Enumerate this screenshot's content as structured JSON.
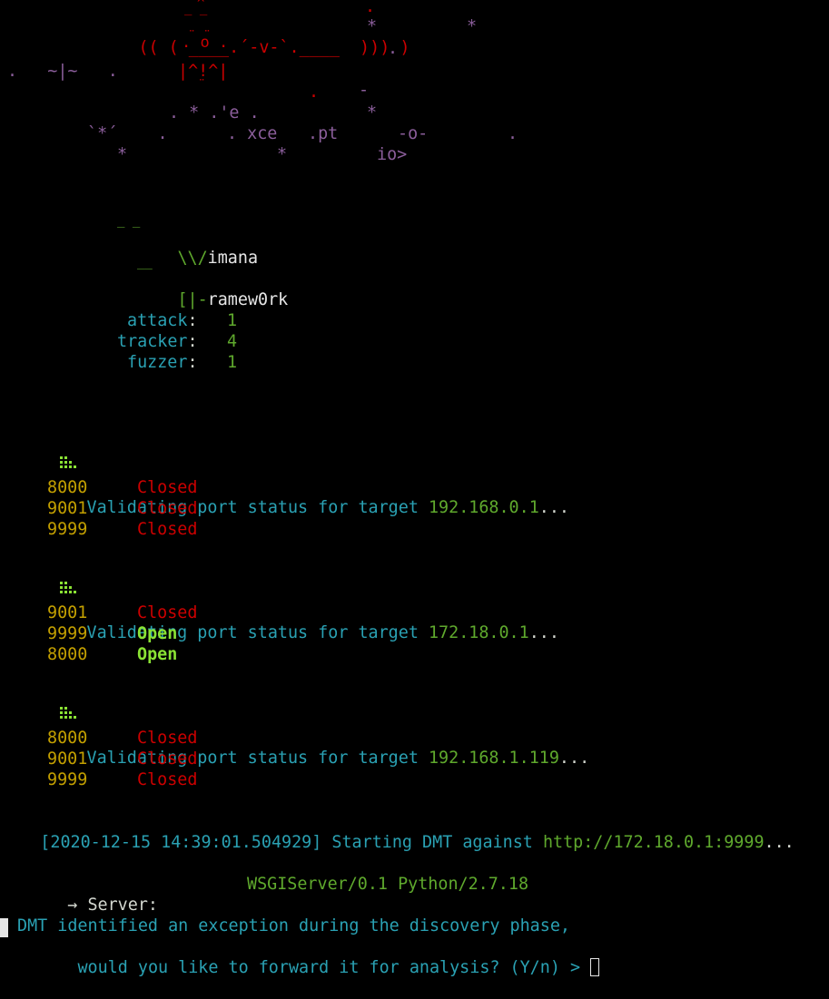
{
  "banner": {
    "line1": {
      "left": "(( ( ____.",
      "mid": "´-v-`",
      "right": ".____  ))) )",
      "star1": "*",
      "star2": "*"
    },
    "hat": "^",
    "hat_under": "_ _",
    "face": ". o .",
    "face_dots": "¨ ¨",
    "dot_top": ".",
    "dot_right": ".",
    "line3_left": ".   ~|~   .",
    "line3_body": "|^!^|",
    "feet": "¨",
    "line4_dot": ".",
    "line4_dash": "-",
    "line5": ". * .'e .",
    "line5_star": "*",
    "line6_left": "`*´    .",
    "line6_xce": ". xce",
    "line6_pt": ".pt",
    "line6_o": "-o-",
    "line6_dot": ".",
    "line7_star1": "*",
    "line7_star2": "*",
    "line7_io": "io>"
  },
  "logo": {
    "vimana_prefix": "\\\\/",
    "vimana_rest": "imana",
    "vimana_over": "_ _",
    "framework_prefix": "[|-",
    "framework_rest": "ramew0rk",
    "framework_over": "__"
  },
  "modules": [
    {
      "name": "attack",
      "count": "1"
    },
    {
      "name": "tracker",
      "count": "4"
    },
    {
      "name": "fuzzer",
      "count": "1"
    }
  ],
  "scans": [
    {
      "label": "Validating port status for target",
      "target": "192.168.0.1",
      "ellipsis": "...",
      "ports": [
        {
          "port": "8000",
          "status": "Closed"
        },
        {
          "port": "9001",
          "status": "Closed"
        },
        {
          "port": "9999",
          "status": "Closed"
        }
      ]
    },
    {
      "label": "Validating port status for target",
      "target": "172.18.0.1",
      "ellipsis": "...",
      "ports": [
        {
          "port": "9001",
          "status": "Closed"
        },
        {
          "port": "9999",
          "status": "Open"
        },
        {
          "port": "8000",
          "status": "Open"
        }
      ]
    },
    {
      "label": "Validating port status for target",
      "target": "192.168.1.119",
      "ellipsis": "...",
      "ports": [
        {
          "port": "8000",
          "status": "Closed"
        },
        {
          "port": "9001",
          "status": "Closed"
        },
        {
          "port": "9999",
          "status": "Closed"
        }
      ]
    }
  ],
  "start": {
    "timestamp": "[2020-12-15 14:39:01.504929]",
    "text": "Starting DMT against",
    "url": "http://172.18.0.1:9999",
    "ellipsis": "..."
  },
  "server": {
    "arrow": "→",
    "label": "Server:",
    "value": "WSGIServer/0.1 Python/2.7.18"
  },
  "prompt": {
    "line1": "DMT identified an exception during the discovery phase,",
    "line2": "would you like to forward it for analysis? (Y/n) >"
  },
  "colors": {
    "background": "#000000",
    "red": "#cc0000",
    "cyan": "#2aa1b3",
    "green": "#5fa92d",
    "bright_green": "#8ae234",
    "yellow": "#c4a000",
    "purple": "#8b5e9b"
  }
}
